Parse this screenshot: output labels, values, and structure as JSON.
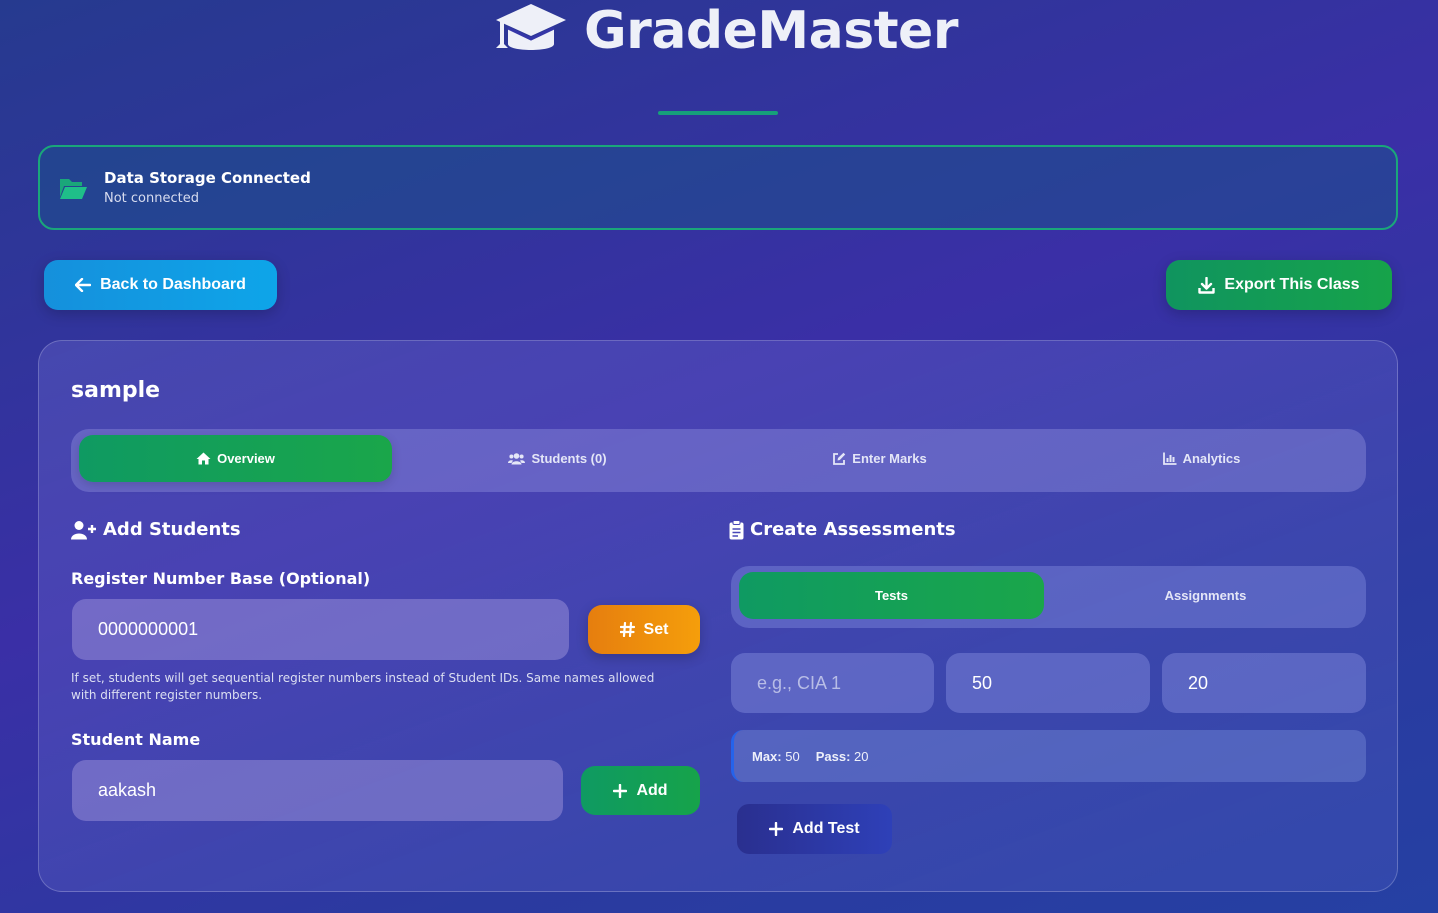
{
  "app": {
    "title": "GradeMaster"
  },
  "storage": {
    "title": "Data Storage Connected",
    "status": "Not connected"
  },
  "toolbar": {
    "back_label": "Back to Dashboard",
    "export_label": "Export This Class"
  },
  "class": {
    "name": "sample"
  },
  "tabs": [
    {
      "label": "Overview",
      "icon": "home-icon",
      "active": true
    },
    {
      "label": "Students (0)",
      "icon": "users-icon",
      "active": false
    },
    {
      "label": "Enter Marks",
      "icon": "edit-icon",
      "active": false
    },
    {
      "label": "Analytics",
      "icon": "chart-icon",
      "active": false
    }
  ],
  "add_students": {
    "title": "Add Students",
    "register_label": "Register Number Base (Optional)",
    "register_value": "0000000001",
    "set_label": "Set",
    "hint": "If set, students will get sequential register numbers instead of Student IDs. Same names allowed with different register numbers.",
    "name_label": "Student Name",
    "name_value": "aakash",
    "add_label": "Add"
  },
  "assessments": {
    "title": "Create Assessments",
    "subtabs": [
      {
        "label": "Tests",
        "active": true
      },
      {
        "label": "Assignments",
        "active": false
      }
    ],
    "name_placeholder": "e.g., CIA 1",
    "max_value": "50",
    "pass_value": "20",
    "info_max_label": "Max:",
    "info_max_value": "50",
    "info_pass_label": "Pass:",
    "info_pass_value": "20",
    "add_test_label": "Add Test"
  },
  "colors": {
    "accent_green": "#16a34a",
    "accent_blue": "#0ea5e9",
    "accent_orange": "#f59e0b",
    "storage_border": "#1aa77a"
  }
}
